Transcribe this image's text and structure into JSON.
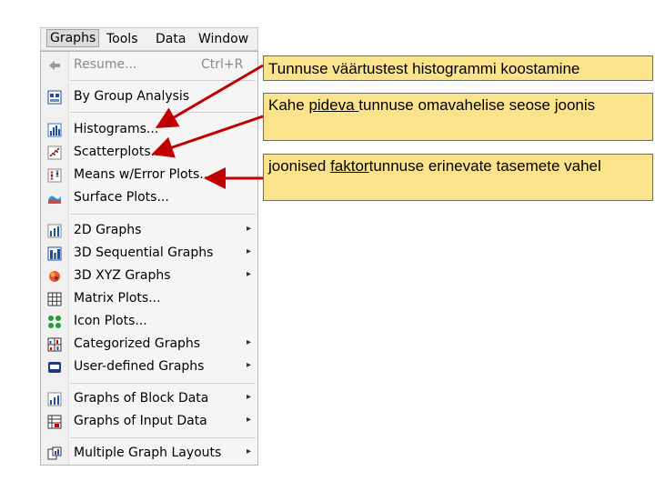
{
  "menubar": {
    "items": [
      {
        "label": "Graphs",
        "active": true
      },
      {
        "label": "Tools"
      },
      {
        "label": "Data"
      },
      {
        "label": "Window"
      }
    ]
  },
  "menu": {
    "items": [
      {
        "label": "Resume...",
        "shortcut": "Ctrl+R",
        "icon": "resume-arrow-icon",
        "disabled": true
      },
      {
        "label": "By Group Analysis",
        "icon": "bygroup-icon"
      },
      {
        "label": "Histograms...",
        "icon": "histogram-icon"
      },
      {
        "label": "Scatterplots...",
        "icon": "scatterplot-icon"
      },
      {
        "label": "Means w/Error Plots...",
        "icon": "error-plot-icon"
      },
      {
        "label": "Surface Plots...",
        "icon": "surface-plot-icon"
      },
      {
        "label": "2D Graphs",
        "icon": "2d-graph-icon",
        "submenu": true
      },
      {
        "label": "3D Sequential Graphs",
        "icon": "3d-sequential-icon",
        "submenu": true
      },
      {
        "label": "3D XYZ Graphs",
        "icon": "3d-xyz-icon",
        "submenu": true
      },
      {
        "label": "Matrix Plots...",
        "icon": "matrix-plot-icon"
      },
      {
        "label": "Icon Plots...",
        "icon": "icon-plot-icon"
      },
      {
        "label": "Categorized Graphs",
        "icon": "categorized-graph-icon",
        "submenu": true
      },
      {
        "label": "User-defined Graphs",
        "icon": "user-defined-icon",
        "submenu": true
      },
      {
        "label": "Graphs of Block Data",
        "icon": "block-data-icon",
        "submenu": true
      },
      {
        "label": "Graphs of Input Data",
        "icon": "input-data-icon",
        "submenu": true
      },
      {
        "label": "Multiple Graph Layouts",
        "icon": "layout-icon",
        "submenu": true
      }
    ]
  },
  "callouts": [
    {
      "text": "Tunnuse väärtustest histogrammi koostamine"
    },
    {
      "pre": "Kahe ",
      "underlined": "pideva ",
      "post": "tunnuse omavahelise seose joonis"
    },
    {
      "pre": "joonised ",
      "underlined": "faktor",
      "post": "tunnuse erinevate tasemete vahel"
    }
  ],
  "colors": {
    "callout_bg": "#fbe38c",
    "arrow": "#c00000",
    "menu_bg": "#f5f5f5"
  }
}
